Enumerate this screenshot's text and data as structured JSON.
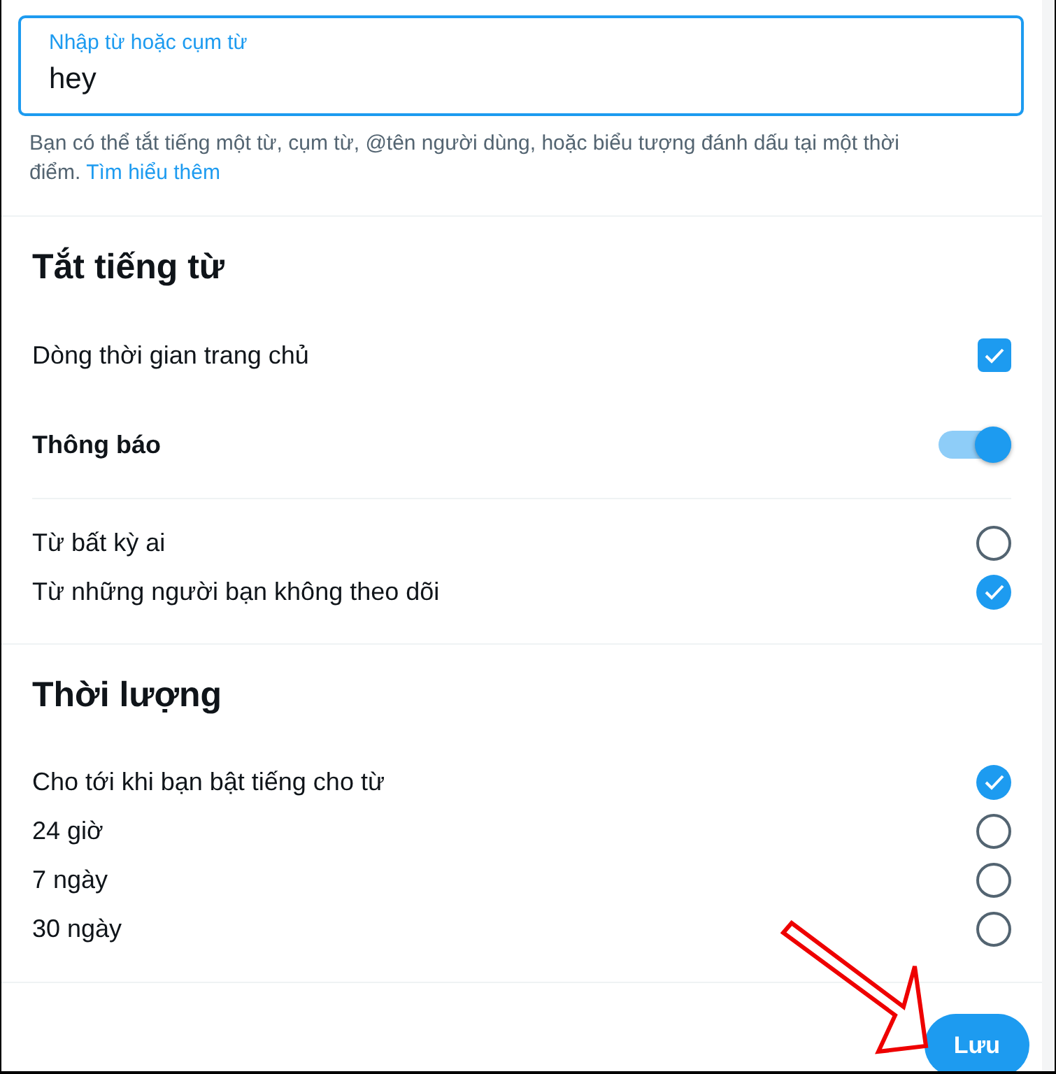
{
  "field": {
    "label": "Nhập từ hoặc cụm từ",
    "value": "hey"
  },
  "help": {
    "text": "Bạn có thể tắt tiếng một từ, cụm từ, @tên người dùng, hoặc biểu tượng đánh dấu tại một thời điểm.",
    "link": "Tìm hiểu thêm"
  },
  "mute_section": {
    "title": "Tắt tiếng từ",
    "rows": [
      {
        "kind": "checkbox",
        "label": "Dòng thời gian trang chủ",
        "checked": true
      },
      {
        "kind": "switch",
        "label": "Thông báo",
        "on": true
      }
    ],
    "audience": [
      {
        "label": "Từ bất kỳ ai",
        "selected": false
      },
      {
        "label": "Từ những người bạn không theo dõi",
        "selected": true
      }
    ]
  },
  "duration_section": {
    "title": "Thời lượng",
    "options": [
      {
        "label": "Cho tới khi bạn bật tiếng cho từ",
        "selected": true
      },
      {
        "label": "24 giờ",
        "selected": false
      },
      {
        "label": "7 ngày",
        "selected": false
      },
      {
        "label": "30 ngày",
        "selected": false
      }
    ]
  },
  "save_button": "Lưu"
}
